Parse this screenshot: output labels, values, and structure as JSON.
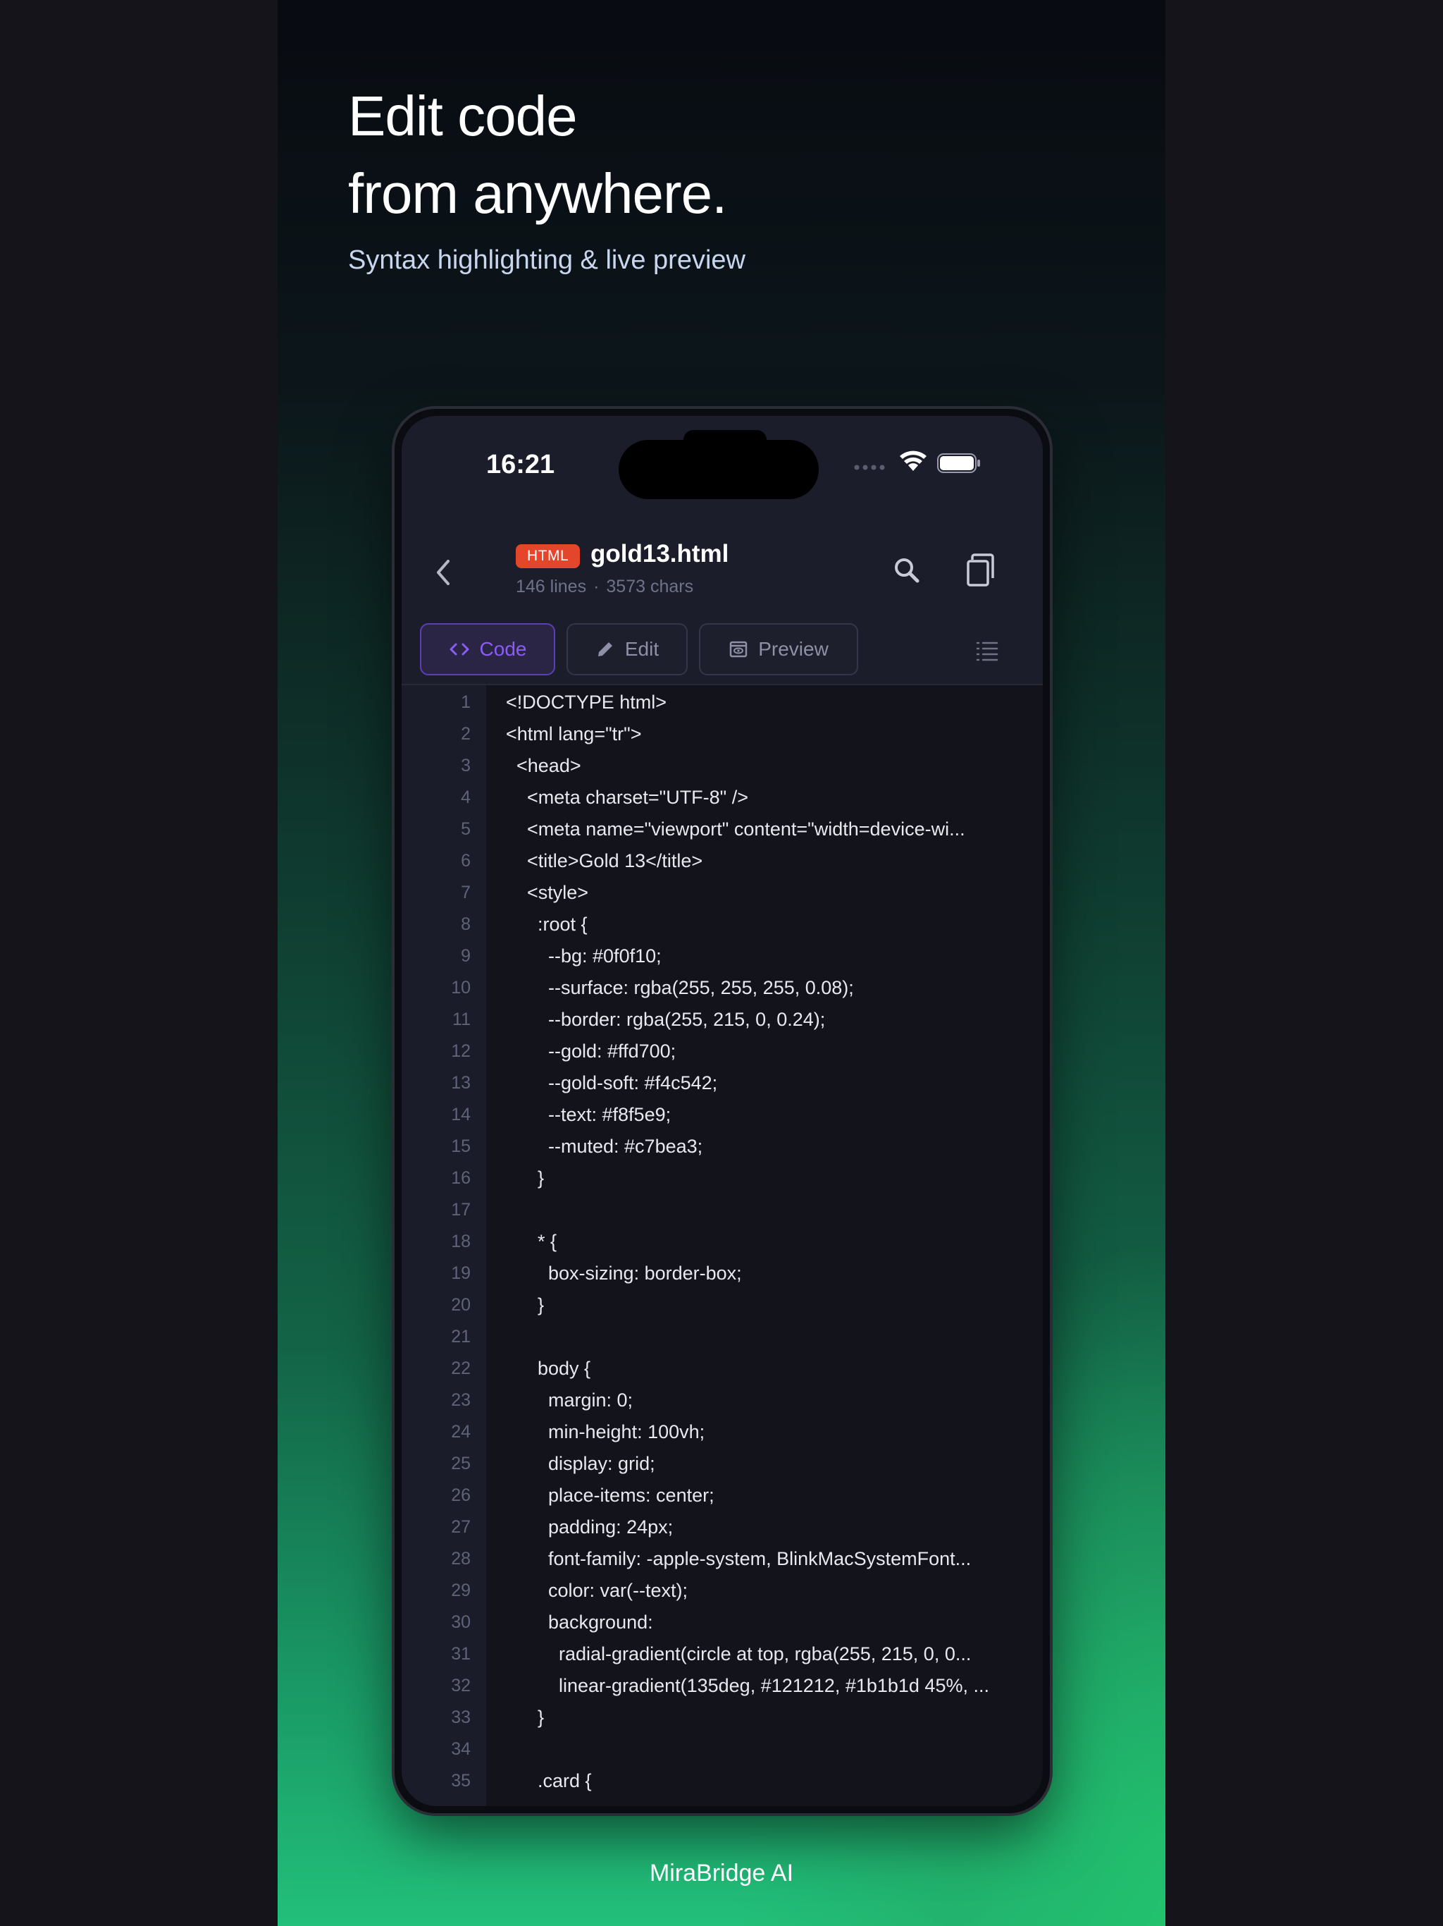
{
  "hero": {
    "title_line1": "Edit code",
    "title_line2": "from anywhere.",
    "subtitle": "Syntax highlighting & live preview"
  },
  "brand": "MiraBridge AI",
  "status_bar": {
    "time": "16:21"
  },
  "file": {
    "badge": "HTML",
    "name": "gold13.html",
    "lines": "146 lines",
    "separator": "·",
    "chars": "3573 chars"
  },
  "tabs": [
    {
      "label": "Code",
      "active": true
    },
    {
      "label": "Edit",
      "active": false
    },
    {
      "label": "Preview",
      "active": false
    }
  ],
  "icons": {
    "back": "chevron-left-icon",
    "search": "search-icon",
    "copy": "copy-icon",
    "outline": "list-icon",
    "code_tab": "code-brackets-icon",
    "edit_tab": "pencil-icon",
    "preview_tab": "eye-icon"
  },
  "colors": {
    "accent": "#8b5cf6",
    "badge": "#e4462b",
    "brand_green": "#22c07a"
  },
  "code_lines": [
    {
      "n": "1",
      "text": "<!DOCTYPE html>"
    },
    {
      "n": "2",
      "text": "<html lang=\"tr\">"
    },
    {
      "n": "3",
      "text": "  <head>"
    },
    {
      "n": "4",
      "text": "    <meta charset=\"UTF-8\" />"
    },
    {
      "n": "5",
      "text": "    <meta name=\"viewport\" content=\"width=device-wi..."
    },
    {
      "n": "6",
      "text": "    <title>Gold 13</title>"
    },
    {
      "n": "7",
      "text": "    <style>"
    },
    {
      "n": "8",
      "text": "      :root {"
    },
    {
      "n": "9",
      "text": "        --bg: #0f0f10;"
    },
    {
      "n": "10",
      "text": "        --surface: rgba(255, 255, 255, 0.08);"
    },
    {
      "n": "11",
      "text": "        --border: rgba(255, 215, 0, 0.24);"
    },
    {
      "n": "12",
      "text": "        --gold: #ffd700;"
    },
    {
      "n": "13",
      "text": "        --gold-soft: #f4c542;"
    },
    {
      "n": "14",
      "text": "        --text: #f8f5e9;"
    },
    {
      "n": "15",
      "text": "        --muted: #c7bea3;"
    },
    {
      "n": "16",
      "text": "      }"
    },
    {
      "n": "17",
      "text": ""
    },
    {
      "n": "18",
      "text": "      * {"
    },
    {
      "n": "19",
      "text": "        box-sizing: border-box;"
    },
    {
      "n": "20",
      "text": "      }"
    },
    {
      "n": "21",
      "text": ""
    },
    {
      "n": "22",
      "text": "      body {"
    },
    {
      "n": "23",
      "text": "        margin: 0;"
    },
    {
      "n": "24",
      "text": "        min-height: 100vh;"
    },
    {
      "n": "25",
      "text": "        display: grid;"
    },
    {
      "n": "26",
      "text": "        place-items: center;"
    },
    {
      "n": "27",
      "text": "        padding: 24px;"
    },
    {
      "n": "28",
      "text": "        font-family: -apple-system, BlinkMacSystemFont..."
    },
    {
      "n": "29",
      "text": "        color: var(--text);"
    },
    {
      "n": "30",
      "text": "        background:"
    },
    {
      "n": "31",
      "text": "          radial-gradient(circle at top, rgba(255, 215, 0, 0..."
    },
    {
      "n": "32",
      "text": "          linear-gradient(135deg, #121212, #1b1b1d 45%, ..."
    },
    {
      "n": "33",
      "text": "      }"
    },
    {
      "n": "34",
      "text": ""
    },
    {
      "n": "35",
      "text": "      .card {"
    }
  ]
}
